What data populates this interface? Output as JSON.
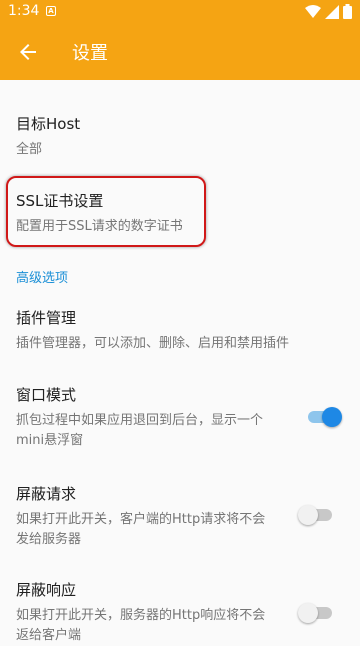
{
  "status_bar": {
    "time": "1:34",
    "notification_letter": "A"
  },
  "app_bar": {
    "title": "设置"
  },
  "prefs": {
    "target_host": {
      "title": "目标Host",
      "summary": "全部"
    },
    "ssl": {
      "title": "SSL证书设置",
      "summary": "配置用于SSL请求的数字证书"
    },
    "advanced_header": "高级选项",
    "plugin": {
      "title": "插件管理",
      "summary": "插件管理器，可以添加、删除、启用和禁用插件"
    },
    "window_mode": {
      "title": "窗口模式",
      "summary_line1": "抓包过程中如果应用退回到后台，显示一个",
      "summary_line2": "mini悬浮窗",
      "enabled": true
    },
    "block_request": {
      "title": "屏蔽请求",
      "summary_line1": "如果打开此开关，客户端的Http请求将不会",
      "summary_line2": "发给服务器",
      "enabled": false
    },
    "block_response": {
      "title": "屏蔽响应",
      "summary_line1": "如果打开此开关，服务器的Http响应将不会",
      "summary_line2": "返给客户端",
      "enabled": false
    }
  },
  "colors": {
    "accent": "#f5a413",
    "link": "#1a8fd6",
    "switch_on": "#1e88e5",
    "highlight": "#d01818"
  }
}
